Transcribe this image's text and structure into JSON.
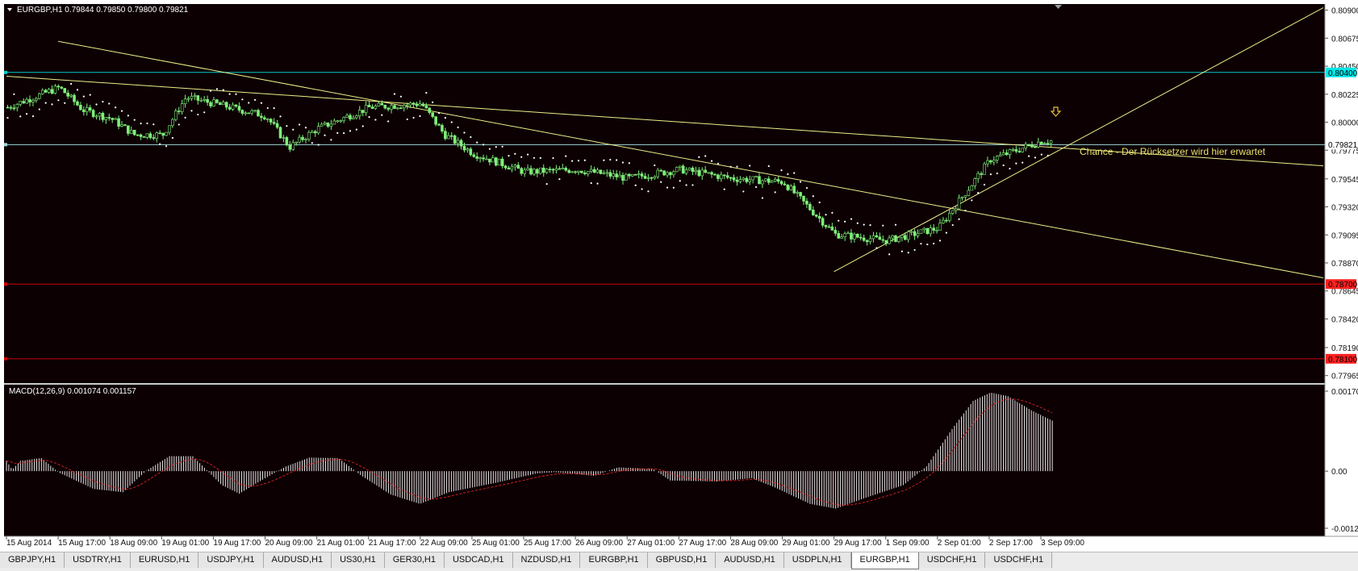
{
  "window": {
    "symbol_caption": "EURGBP,H1  0.79844 0.79850 0.79800 0.79821"
  },
  "main_chart": {
    "price_axis_labels": [
      "0.80900",
      "0.80675",
      "0.80450",
      "0.80225",
      "0.80000",
      "0.79775",
      "0.79545",
      "0.79320",
      "0.79095",
      "0.78870",
      "0.78645",
      "0.78420",
      "0.78190",
      "0.77965"
    ],
    "price_tags": [
      {
        "label": "0.80400",
        "color": "#00e5e5"
      },
      {
        "label": "0.79821",
        "color": "#ffffff"
      },
      {
        "label": "0.78700",
        "color": "#ff2020"
      },
      {
        "label": "0.78100",
        "color": "#ff2020"
      }
    ],
    "annotation": "Chance - Der Rücksetzer wird hier erwartet",
    "arrow_icon": "down-arrow-icon"
  },
  "indicator": {
    "caption": "MACD(12,26,9) 0.001074 0.001157",
    "axis_labels": [
      "0.001709",
      "0.00",
      "-0.00122"
    ]
  },
  "time_axis": [
    "15 Aug 2014",
    "15 Aug 17:00",
    "18 Aug 09:00",
    "19 Aug 01:00",
    "19 Aug 17:00",
    "20 Aug 09:00",
    "21 Aug 01:00",
    "21 Aug 17:00",
    "22 Aug 09:00",
    "25 Aug 01:00",
    "25 Aug 17:00",
    "26 Aug 09:00",
    "27 Aug 01:00",
    "27 Aug 17:00",
    "28 Aug 09:00",
    "29 Aug 01:00",
    "29 Aug 17:00",
    "1 Sep 09:00",
    "2 Sep 01:00",
    "2 Sep 17:00",
    "3 Sep 09:00"
  ],
  "tabs": [
    {
      "label": "GBPJPY,H1",
      "active": false
    },
    {
      "label": "USDTRY,H1",
      "active": false
    },
    {
      "label": "EURUSD,H1",
      "active": false
    },
    {
      "label": "USDJPY,H1",
      "active": false
    },
    {
      "label": "AUDUSD,H1",
      "active": false
    },
    {
      "label": "US30,H1",
      "active": false
    },
    {
      "label": "GER30,H1",
      "active": false
    },
    {
      "label": "USDCAD,H1",
      "active": false
    },
    {
      "label": "NZDUSD,H1",
      "active": false
    },
    {
      "label": "EURGBP,H1",
      "active": false
    },
    {
      "label": "GBPUSD,H1",
      "active": false
    },
    {
      "label": "AUDUSD,H1",
      "active": false
    },
    {
      "label": "USDPLN,H1",
      "active": false
    },
    {
      "label": "EURGBP,H1",
      "active": true
    },
    {
      "label": "USDCHF,H1",
      "active": false
    },
    {
      "label": "USDCHF,H1",
      "active": false
    }
  ],
  "chart_data": [
    {
      "type": "candlestick",
      "symbol": "EURGBP",
      "timeframe": "H1",
      "ylim": [
        0.7795,
        0.8093
      ],
      "anchors": [
        [
          "15 Aug 2014",
          0.8012
        ],
        [
          "15 Aug 17:00",
          0.8028
        ],
        [
          "15 Aug 17:00",
          0.801
        ],
        [
          "18 Aug 09:00",
          0.8003
        ],
        [
          "18 Aug 09:00",
          0.799
        ],
        [
          "19 Aug 01:00",
          0.799
        ],
        [
          "19 Aug 01:00",
          0.802
        ],
        [
          "19 Aug 17:00",
          0.8015
        ],
        [
          "20 Aug 09:00",
          0.8005
        ],
        [
          "20 Aug 09:00",
          0.798
        ],
        [
          "21 Aug 01:00",
          0.7995
        ],
        [
          "21 Aug 17:00",
          0.8012
        ],
        [
          "22 Aug 09:00",
          0.8015
        ],
        [
          "22 Aug 09:00",
          0.799
        ],
        [
          "25 Aug 01:00",
          0.7975
        ],
        [
          "25 Aug 17:00",
          0.796
        ],
        [
          "26 Aug 09:00",
          0.7962
        ],
        [
          "27 Aug 01:00",
          0.7955
        ],
        [
          "27 Aug 17:00",
          0.7962
        ],
        [
          "28 Aug 09:00",
          0.7955
        ],
        [
          "29 Aug 01:00",
          0.7952
        ],
        [
          "29 Aug 17:00",
          0.791
        ],
        [
          "1 Sep 09:00",
          0.7905
        ],
        [
          "2 Sep 01:00",
          0.7915
        ],
        [
          "2 Sep 17:00",
          0.797
        ],
        [
          "3 Sep 09:00",
          0.7985
        ]
      ],
      "horizontal_lines": [
        {
          "price": 0.804,
          "color": "#00cccc"
        },
        {
          "price": 0.7982,
          "color": "#9fd5d5"
        },
        {
          "price": 0.787,
          "color": "#cc0000"
        },
        {
          "price": 0.781,
          "color": "#cc0000"
        }
      ],
      "trendlines": [
        {
          "from": [
            "15 Aug 2014",
            0.8037
          ],
          "to": [
            "3 Sep 09:00 + ",
            0.7965
          ],
          "color": "#eeee88"
        },
        {
          "from": [
            "15 Aug 17:00",
            0.8065
          ],
          "to": [
            "3 Sep 09:00 + ",
            0.7875
          ],
          "color": "#eeee88"
        },
        {
          "from": [
            "29 Aug 17:00",
            0.788
          ],
          "to": [
            "3 Sep 09:00 + ",
            0.8092
          ],
          "color": "#eeee88"
        }
      ],
      "overlay": "parabolic-sar"
    },
    {
      "type": "bar",
      "indicator": "MACD(12,26,9)",
      "main": 0.001074,
      "signal": 0.001157,
      "ylim": [
        -0.00122,
        0.001709
      ],
      "anchors": [
        [
          0,
          0.00022
        ],
        [
          5,
          3e-05
        ],
        [
          12,
          0.00022
        ],
        [
          30,
          0.00028
        ],
        [
          45,
          -3e-05
        ],
        [
          75,
          -0.00038
        ],
        [
          100,
          -0.00045
        ],
        [
          120,
          1e-05
        ],
        [
          140,
          0.00032
        ],
        [
          160,
          0.00032
        ],
        [
          185,
          -0.0003
        ],
        [
          200,
          -0.00048
        ],
        [
          220,
          -0.00018
        ],
        [
          240,
          0.0001
        ],
        [
          260,
          0.00029
        ],
        [
          285,
          0.00028
        ],
        [
          305,
          -0.0001
        ],
        [
          330,
          -0.0005
        ],
        [
          355,
          -0.0007
        ],
        [
          380,
          -0.00045
        ],
        [
          420,
          -0.00025
        ],
        [
          455,
          -5e-05
        ],
        [
          470,
          -2e-05
        ],
        [
          505,
          -0.0001
        ],
        [
          525,
          8e-05
        ],
        [
          555,
          5e-05
        ],
        [
          570,
          -0.0002
        ],
        [
          610,
          -0.00022
        ],
        [
          640,
          -0.00015
        ],
        [
          660,
          -0.00035
        ],
        [
          690,
          -0.0007
        ],
        [
          712,
          -0.0008
        ],
        [
          740,
          -0.00055
        ],
        [
          770,
          -0.0003
        ],
        [
          790,
          0.0001
        ],
        [
          812,
          0.0009
        ],
        [
          830,
          0.0015
        ],
        [
          845,
          0.00168
        ],
        [
          860,
          0.0016
        ],
        [
          880,
          0.0013
        ],
        [
          898,
          0.00108
        ]
      ]
    }
  ]
}
